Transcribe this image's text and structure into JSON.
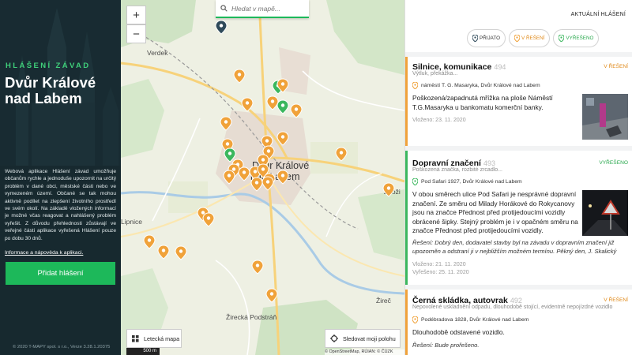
{
  "left_panel": {
    "spaced_heading": "HLÁŠENÍ ZÁVAD",
    "title": "Dvůr Králové nad Labem",
    "description": "Webová aplikace Hlášení závad umožňuje občanům rychle a jednoduše upozornit na určitý problém v dané obci, městské části nebo ve vymezeném území. Občané se tak mohou aktivně podílet na zlepšení životního prostředí ve svém okolí. Na základě vložených informací je možné včas reagovat a nahlášený problém vyřešit. Z důvodu přehlednosti zůstávají ve veřejné části aplikace vyřešená Hlášení pouze po dobu 30 dnů.",
    "help_link": "Informace a nápověda k aplikaci.",
    "add_button": "Přidat hlášení",
    "copyright": "© 2020 T-MAPY spol. s r.o., Verze 3.28.1.20375"
  },
  "map": {
    "search_placeholder": "Hledat v mapě...",
    "zoom_in": "+",
    "zoom_out": "−",
    "labels": {
      "verdek": "Verdek",
      "town_line1": "Dvůr Králové",
      "town_line2": "nad Labem",
      "lipnice": "Lipnice",
      "zirec": "Žireč",
      "zirecka": "Žirecká Podstráň",
      "zizc": "Zdoži"
    },
    "aerial_button": "Letecká mapa",
    "scale": "500 m",
    "locate_button": "Sledovat moji polohu",
    "attribution": "© OpenStreetMap, RÚIAN: © ČÚZK",
    "colors": {
      "pin_open": "#f0a23a",
      "pin_done": "#3bb75e",
      "pin_new": "#2f4a5a"
    }
  },
  "right_panel": {
    "header": "AKTUÁLNÍ HLÁŠENÍ",
    "filters": [
      {
        "label": "PŘIJATO",
        "icon": "map-pin-icon",
        "color": "#2f4a5a"
      },
      {
        "label": "V ŘEŠENÍ",
        "icon": "map-pin-icon",
        "color": "#f0a23a"
      },
      {
        "label": "VYŘEŠENO",
        "icon": "map-pin-icon",
        "color": "#3bb75e"
      }
    ],
    "cards": [
      {
        "title": "Silnice, komunikace",
        "number": "494",
        "subtitle": "Výtluk, překážka...",
        "status": "V ŘEŠENÍ",
        "address": "náměstí T. G. Masaryka, Dvůr Králové nad Labem",
        "text_line1": "Poškozená/zapadnutá mřížka na ploše Náměstí",
        "text_line2": "T.G.Masaryka u bankomatu komerční banky.",
        "date": "Vloženo: 23. 11. 2020"
      },
      {
        "title": "Dopravní značení",
        "number": "493",
        "subtitle": "Poškozená značka, rozbité zrcadlo...",
        "status": "VYŘEŠENO",
        "address": "Pod Safari 1927, Dvůr Králové nad Labem",
        "text_line1": "V obou směrech ulice Pod Safari je nesprávné dopravní",
        "text_line2": "značení. Ze směru od Milady Horákové do Rokycanovy",
        "text_line3": "jsou na značce Přednost před protijedoucími vozidly",
        "text_line4": "obrácené šipky. Stejný problém je i v opačném směru na",
        "text_line5": "značce Přednost před protijedoucími vozidly.",
        "reply_line1": "Řešení: Dobrý den, dodavatel stavby byl na závadu v dopravním značení již",
        "reply_line2": "upozorněn a odstraní ji v nejbližším možném termínu. Pěkný den, J. Skalický",
        "date_inserted": "Vloženo: 21. 11. 2020",
        "date_resolved": "Vyřešeno: 25. 11. 2020"
      },
      {
        "title": "Černá skládka, autovrak",
        "number": "492",
        "subtitle": "Nepovolené uskladnění odpadu, dlouhodobě stojící, evidentně nepojízdné vozidlo",
        "status": "V ŘEŠENÍ",
        "address": "Podébradova 1828, Dvůr Králové nad Labem",
        "text_line1": "Dlouhodobě odstavené vozidlo.",
        "reply_line1": "Řešení: Bude prořešeno."
      }
    ]
  }
}
